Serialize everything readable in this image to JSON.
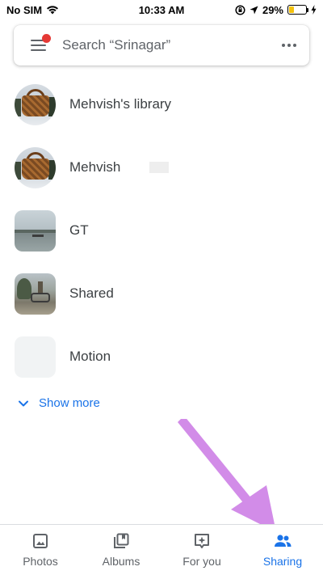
{
  "status_bar": {
    "carrier": "No SIM",
    "time": "10:33 AM",
    "battery_percent": "29%",
    "battery_level": 0.29,
    "icons": [
      "wifi-icon",
      "orientation-lock-icon",
      "location-icon",
      "battery-icon",
      "charging-icon"
    ]
  },
  "search": {
    "placeholder": "Search “Srinagar”",
    "menu_icon": "hamburger-menu-icon",
    "more_icon": "more-horizontal-icon"
  },
  "list": {
    "items": [
      {
        "label": "Mehvish's library",
        "thumb": "circle"
      },
      {
        "label": "Mehvish",
        "thumb": "circle"
      },
      {
        "label": "GT",
        "thumb": "rounded"
      },
      {
        "label": "Shared",
        "thumb": "rounded"
      },
      {
        "label": "Motion",
        "thumb": "empty"
      }
    ],
    "show_more": "Show more"
  },
  "bottom_nav": {
    "items": [
      {
        "label": "Photos",
        "icon": "photo-icon",
        "active": false
      },
      {
        "label": "Albums",
        "icon": "albums-icon",
        "active": false
      },
      {
        "label": "For you",
        "icon": "for-you-icon",
        "active": false
      },
      {
        "label": "Sharing",
        "icon": "people-icon",
        "active": true
      }
    ]
  },
  "colors": {
    "accent": "#1a73e8",
    "notification_dot": "#e53935",
    "annotation_arrow": "#d28ce8",
    "battery_fill": "#f4c20d"
  }
}
